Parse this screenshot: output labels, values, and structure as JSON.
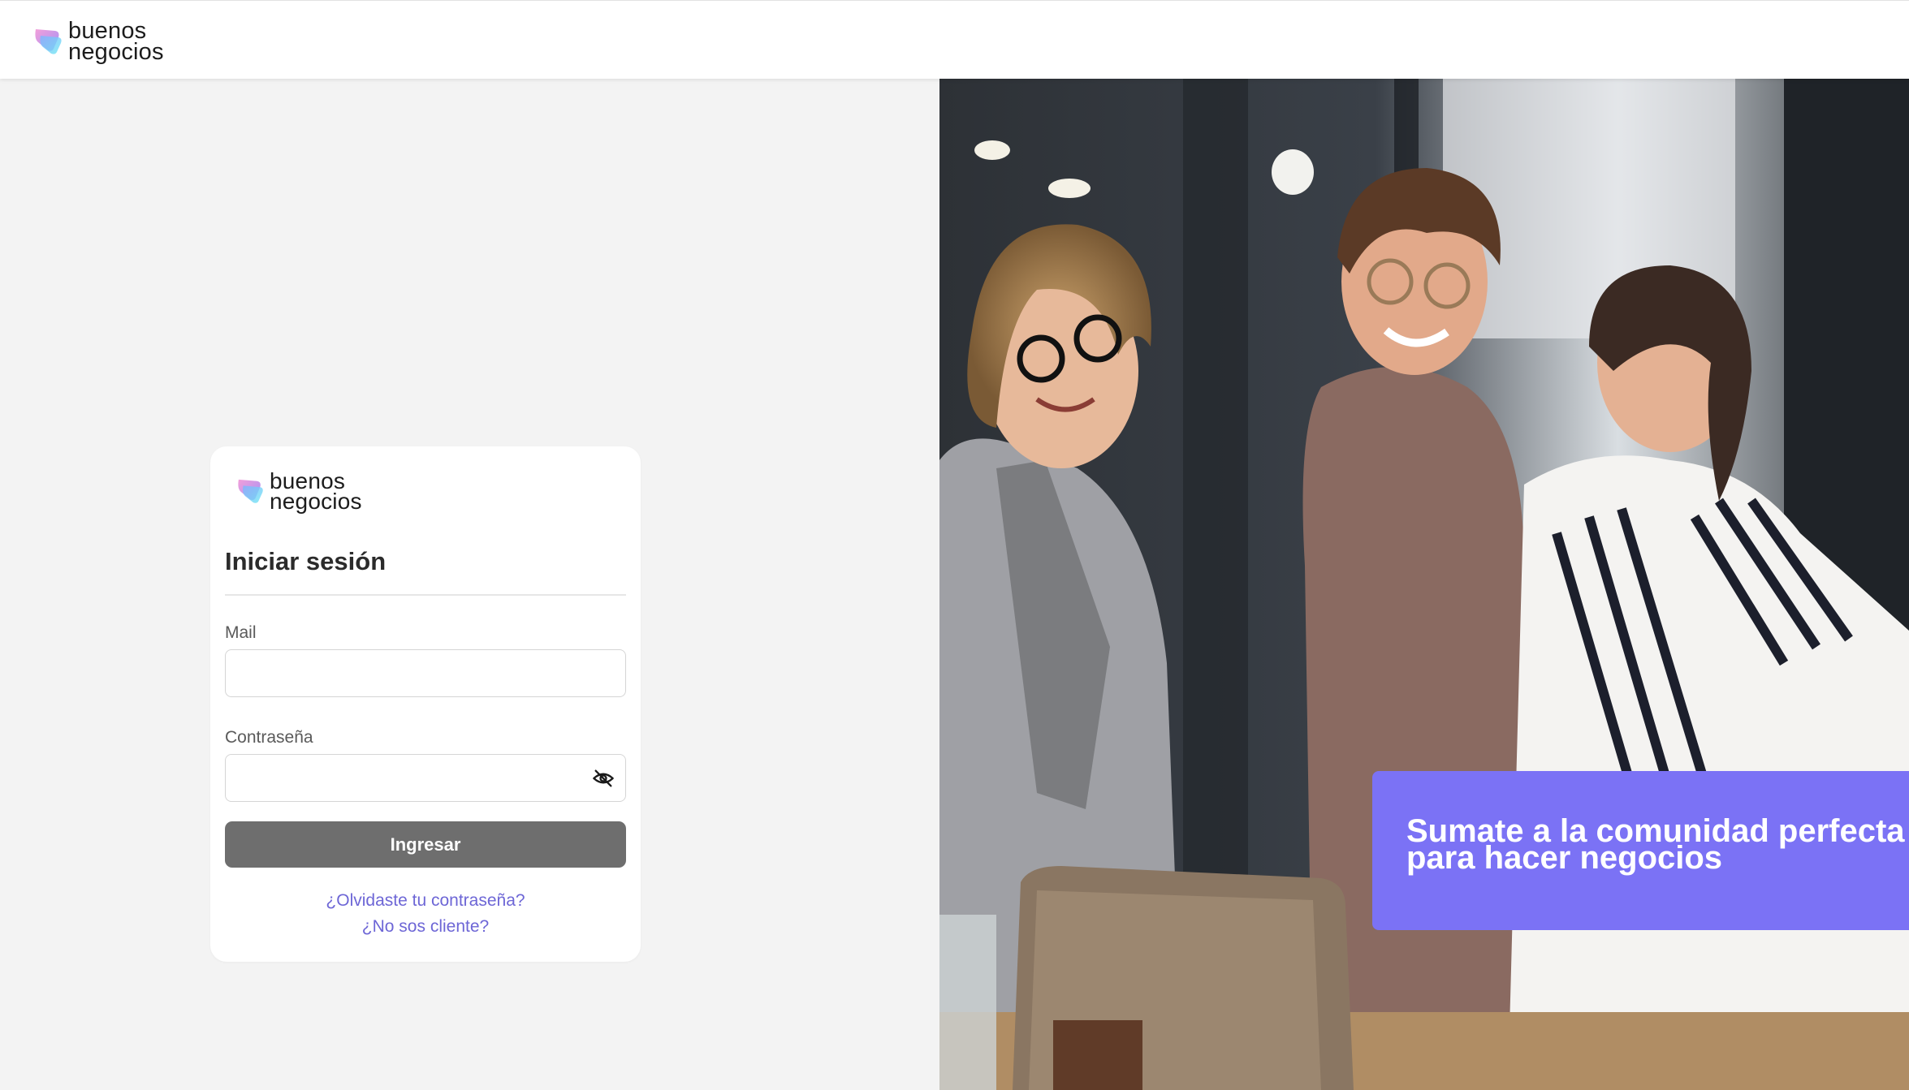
{
  "brand": {
    "name_line1": "buenos",
    "name_line2": "negocios"
  },
  "login": {
    "title": "Iniciar sesión",
    "mail_label": "Mail",
    "mail_value": "",
    "password_label": "Contraseña",
    "password_value": "",
    "submit_label": "Ingresar",
    "forgot_link": "¿Olvidaste tu contraseña?",
    "signup_link": "¿No sos cliente?"
  },
  "promo": {
    "line1": "Sumate a la comunidad perfecta",
    "line2": "para hacer negocios"
  },
  "icons": {
    "password_toggle": "eye-off-icon",
    "logo": "logo-icon"
  },
  "colors": {
    "accent": "#7b72f5",
    "link": "#6d66d6",
    "button": "#6e6e6e",
    "background": "#f3f3f3"
  }
}
